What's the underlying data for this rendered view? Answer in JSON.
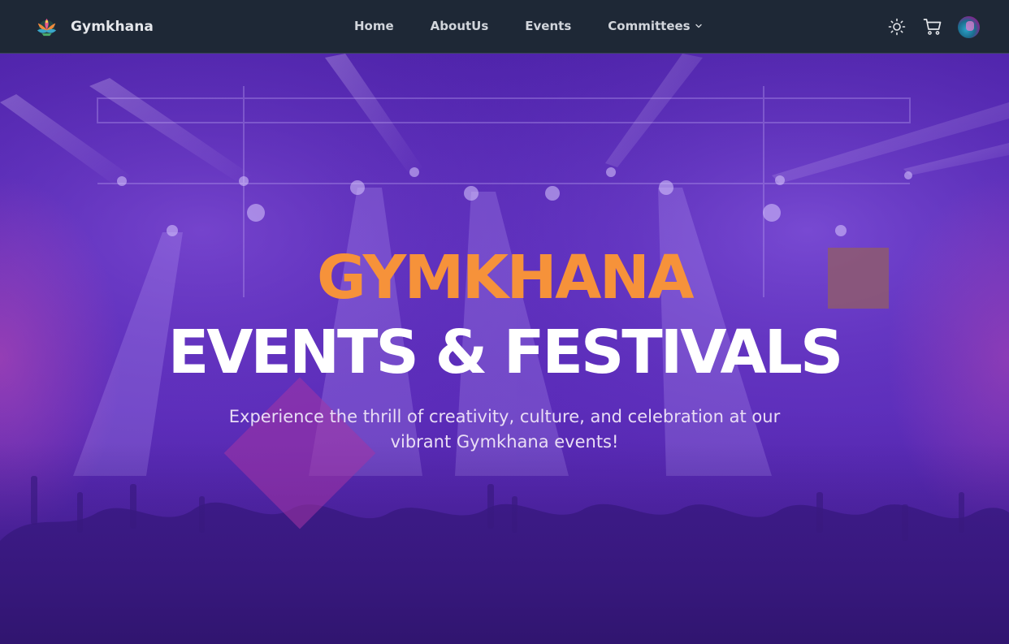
{
  "header": {
    "brand": "Gymkhana",
    "logo_icon": "lotus-logo-icon"
  },
  "nav": {
    "home": "Home",
    "about": "AboutUs",
    "events": "Events",
    "committees": "Committees"
  },
  "actions": {
    "theme_icon": "sun-icon",
    "cart_icon": "cart-icon",
    "avatar_icon": "user-avatar"
  },
  "hero": {
    "title_line1": "GYMKHANA",
    "title_line2": "EVENTS & FESTIVALS",
    "subtitle": "Experience the thrill of creativity, culture, and celebration at our vibrant Gymkhana events!"
  },
  "colors": {
    "navbar_bg": "#1e2836",
    "accent_orange": "#f6923a",
    "hero_purple": "#5628b6",
    "title_white": "#ffffff"
  }
}
